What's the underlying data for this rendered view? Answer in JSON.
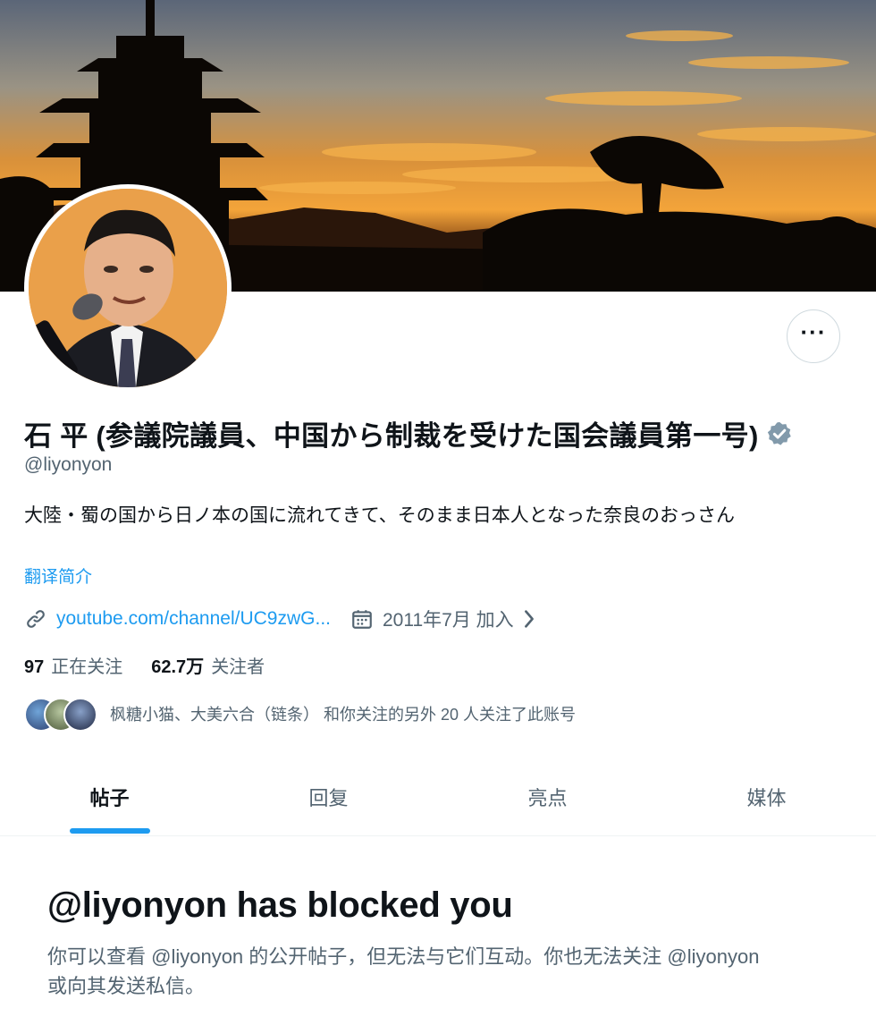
{
  "profile": {
    "display_name": "石 平 (参議院議員、中国から制裁を受けた国会議員第一号)",
    "handle": "@liyonyon",
    "bio": "大陸・蜀の国から日ノ本の国に流れてきて、そのまま日本人となった奈良のおっさん",
    "translate_label": "翻译简介",
    "website": "youtube.com/channel/UC9zwG...",
    "joined": "2011年7月 加入",
    "following_count": "97",
    "following_label": "正在关注",
    "followers_count": "62.7万",
    "followers_label": "关注者",
    "known_followers_text": "枫糖小猫、大美六合（链条） 和你关注的另外 20 人关注了此账号",
    "verified_color": "#829aab"
  },
  "actions": {
    "more_label": "···"
  },
  "tabs": [
    {
      "label": "帖子",
      "active": true
    },
    {
      "label": "回复",
      "active": false
    },
    {
      "label": "亮点",
      "active": false
    },
    {
      "label": "媒体",
      "active": false
    }
  ],
  "blocked": {
    "title": "@liyonyon has blocked you",
    "description": "你可以查看 @liyonyon 的公开帖子，但无法与它们互动。你也无法关注 @liyonyon 或向其发送私信。"
  },
  "colors": {
    "accent": "#1d9bf0",
    "secondary_text": "#536471"
  }
}
